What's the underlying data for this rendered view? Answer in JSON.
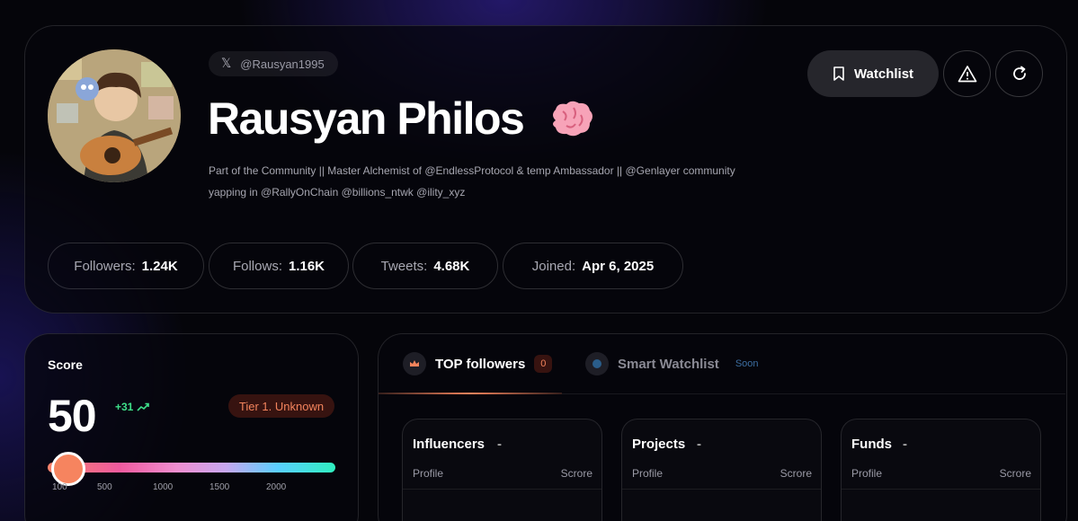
{
  "profile": {
    "handle": "@Rausyan1995",
    "display_name": "Rausyan Philos",
    "bio_line1": "Part of the Community || Master Alchemist of @EndlessProtocol & temp Ambassador || @Genlayer community",
    "bio_line2": "yapping in @RallyOnChain @billions_ntwk @ility_xyz",
    "icons": {
      "handle": "x-logo-icon",
      "name_badge": "brain-icon"
    }
  },
  "actions": {
    "watchlist_label": "Watchlist",
    "icons": [
      "bookmark-icon",
      "warning-icon",
      "refresh-icon"
    ]
  },
  "stats": [
    {
      "label": "Followers:",
      "value": "1.24K"
    },
    {
      "label": "Follows:",
      "value": "1.16K"
    },
    {
      "label": "Tweets:",
      "value": "4.68K"
    },
    {
      "label": "Joined:",
      "value": "Apr 6, 2025"
    }
  ],
  "score": {
    "title": "Score",
    "value": "50",
    "delta": "+31",
    "tier": "Tier 1. Unknown",
    "ticks": [
      "100",
      "500",
      "1000",
      "1500",
      "2000"
    ],
    "accent": "#f6845f"
  },
  "tabs": [
    {
      "label": "TOP followers",
      "count": "0"
    },
    {
      "label": "Smart Watchlist",
      "badge": "Soon"
    }
  ],
  "categories": [
    {
      "title": "Influencers",
      "value": "-",
      "col_profile": "Profile",
      "col_score": "Scrore"
    },
    {
      "title": "Projects",
      "value": "-",
      "col_profile": "Profile",
      "col_score": "Scrore"
    },
    {
      "title": "Funds",
      "value": "-",
      "col_profile": "Profile",
      "col_score": "Scrore"
    }
  ]
}
